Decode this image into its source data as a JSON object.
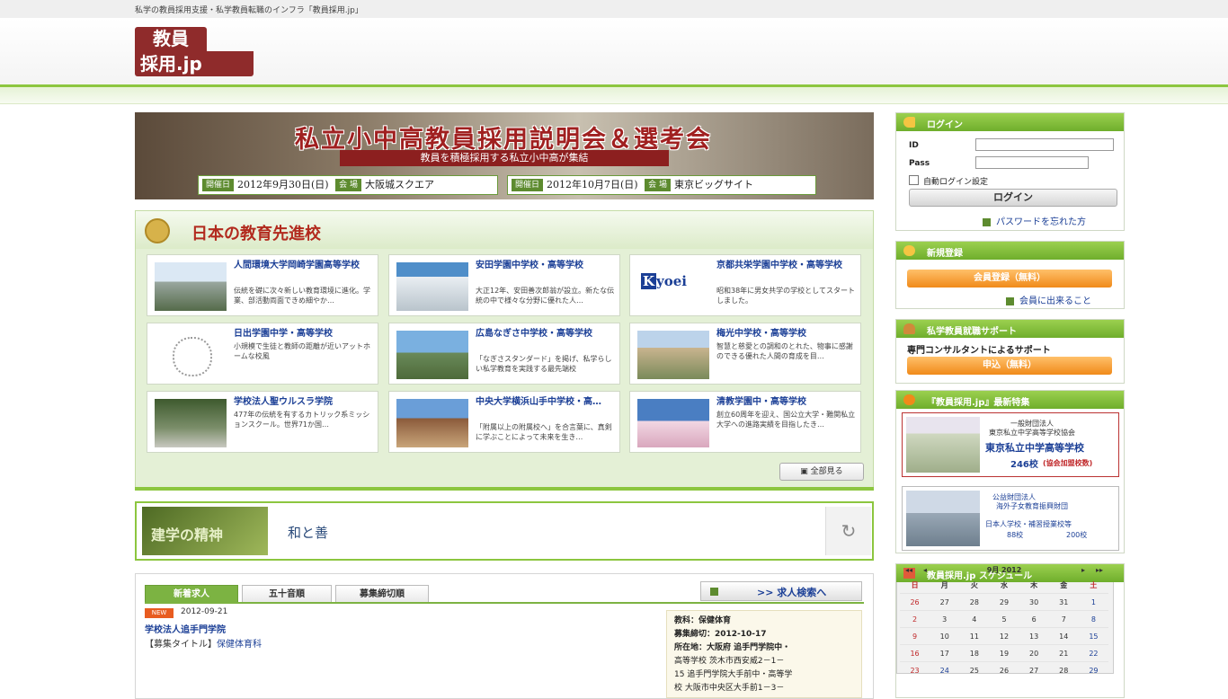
{
  "header": {
    "tagline": "私学の教員採用支援・私学教員転職のインフラ「教員採用.jp」",
    "logo_line1": "教員",
    "logo_line2": "採用.jp"
  },
  "banner": {
    "title": "私立小中高教員採用説明会＆選考会",
    "subtitle": "教員を積極採用する私立小中高が集結",
    "event1": {
      "date_label": "開催日",
      "date": "2012年9月30日(日)",
      "venue_label": "会 場",
      "venue": "大阪城スクエア"
    },
    "event2": {
      "date_label": "開催日",
      "date": "2012年10月7日(日)",
      "venue_label": "会 場",
      "venue": "東京ビッグサイト"
    }
  },
  "schools": {
    "title": "日本の教育先進校",
    "see_all": "全部見る",
    "items": [
      {
        "name": "人間環境大学岡崎学園高等学校",
        "desc": "伝統を礎に次々新しい教育環境に進化。学業、部活動両面できめ細やか…"
      },
      {
        "name": "安田学園中学校・高等学校",
        "desc": "大正12年、安田善次郎翁が設立。新たな伝統の中で様々な分野に優れた人…"
      },
      {
        "name": "京都共栄学園中学校・高等学校",
        "desc": "昭和38年に男女共学の学校としてスタートしました。"
      },
      {
        "name": "日出学園中学・高等学校",
        "desc": "小規模で生徒と教師の距離が近いアットホームな校風"
      },
      {
        "name": "広島なぎさ中学校・高等学校",
        "desc": "「なぎさスタンダード」を掲げ、私学らしい私学教育を実践する最先端校"
      },
      {
        "name": "梅光中学校・高等学校",
        "desc": "智慧と慈愛との調和のとれた、物事に感謝のできる優れた人間の育成を目…"
      },
      {
        "name": "学校法人聖ウルスラ学院",
        "desc": "477年の伝統を有するカトリック系ミッションスクール。世界71か国…"
      },
      {
        "name": "中央大学横浜山手中学校・高…",
        "desc": "「附属以上の附属校へ」を合言葉に、真剣に学ぶことによって未来を生き…"
      },
      {
        "name": "清教学園中・高等学校",
        "desc": "創立60周年を迎え、国公立大学・難関私立大学への進路実績を目指したき…"
      }
    ]
  },
  "spirit": {
    "label": "建学の精神",
    "text": "和と善"
  },
  "jobs": {
    "tabs": [
      "新着求人",
      "五十音順",
      "募集締切順"
    ],
    "search_label": ">> 求人検索へ",
    "badge": "NEW",
    "date": "2012-09-21",
    "school": "学校法人追手門学院",
    "category_label": "【募集タイトル】",
    "category": "保健体育科",
    "detail_lines": [
      "教科：保健体育",
      "募集締切：2012-10-17",
      "所在地：大阪府 追手門学院中・",
      "高等学校 茨木市西安威2－1－",
      "15 追手門学院大手前中・高等学",
      "校 大阪市中央区大手前1－3－"
    ]
  },
  "sidebar": {
    "login": {
      "title": "ログイン",
      "id_label": "ID",
      "pass_label": "Pass",
      "auto_login": "自動ログイン設定",
      "button": "ログイン",
      "forgot": "パスワードを忘れた方"
    },
    "register": {
      "title": "新規登録",
      "button": "会員登録（無料）",
      "link": "会員に出来ること"
    },
    "support": {
      "title": "私学教員就職サポート",
      "text": "専門コンサルタントによるサポート",
      "button": "申込（無料）"
    },
    "features": {
      "title": "『教員採用.jp』最新特集",
      "f1_line1": "一般財団法人",
      "f1_line2": "東京私立中学高等学校協会",
      "f1_line3": "東京私立中学高等学校",
      "f1_line4": "246校",
      "f1_line5": "(協会加盟校数)",
      "f2_line1": "公益財団法人",
      "f2_line2": "海外子女教育振興財団",
      "f2_line3": "日本人学校・補習授業校等",
      "f2_line4": "88校",
      "f2_line5": "200校"
    },
    "schedule": {
      "title": "教員採用.jp スケジュール",
      "month": "9月 2012",
      "weekdays": [
        "日",
        "月",
        "火",
        "水",
        "木",
        "金",
        "土"
      ],
      "weeks": [
        [
          "26",
          "27",
          "28",
          "29",
          "30",
          "31",
          "1"
        ],
        [
          "2",
          "3",
          "4",
          "5",
          "6",
          "7",
          "8"
        ],
        [
          "9",
          "10",
          "11",
          "12",
          "13",
          "14",
          "15"
        ],
        [
          "16",
          "17",
          "18",
          "19",
          "20",
          "21",
          "22"
        ],
        [
          "23",
          "24",
          "25",
          "26",
          "27",
          "28",
          "29"
        ]
      ]
    }
  },
  "colors": {
    "accent_green": "#8cc63f",
    "brand_red": "#8f2b2b",
    "link_blue": "#1b3f96",
    "orange": "#f08a1a"
  }
}
